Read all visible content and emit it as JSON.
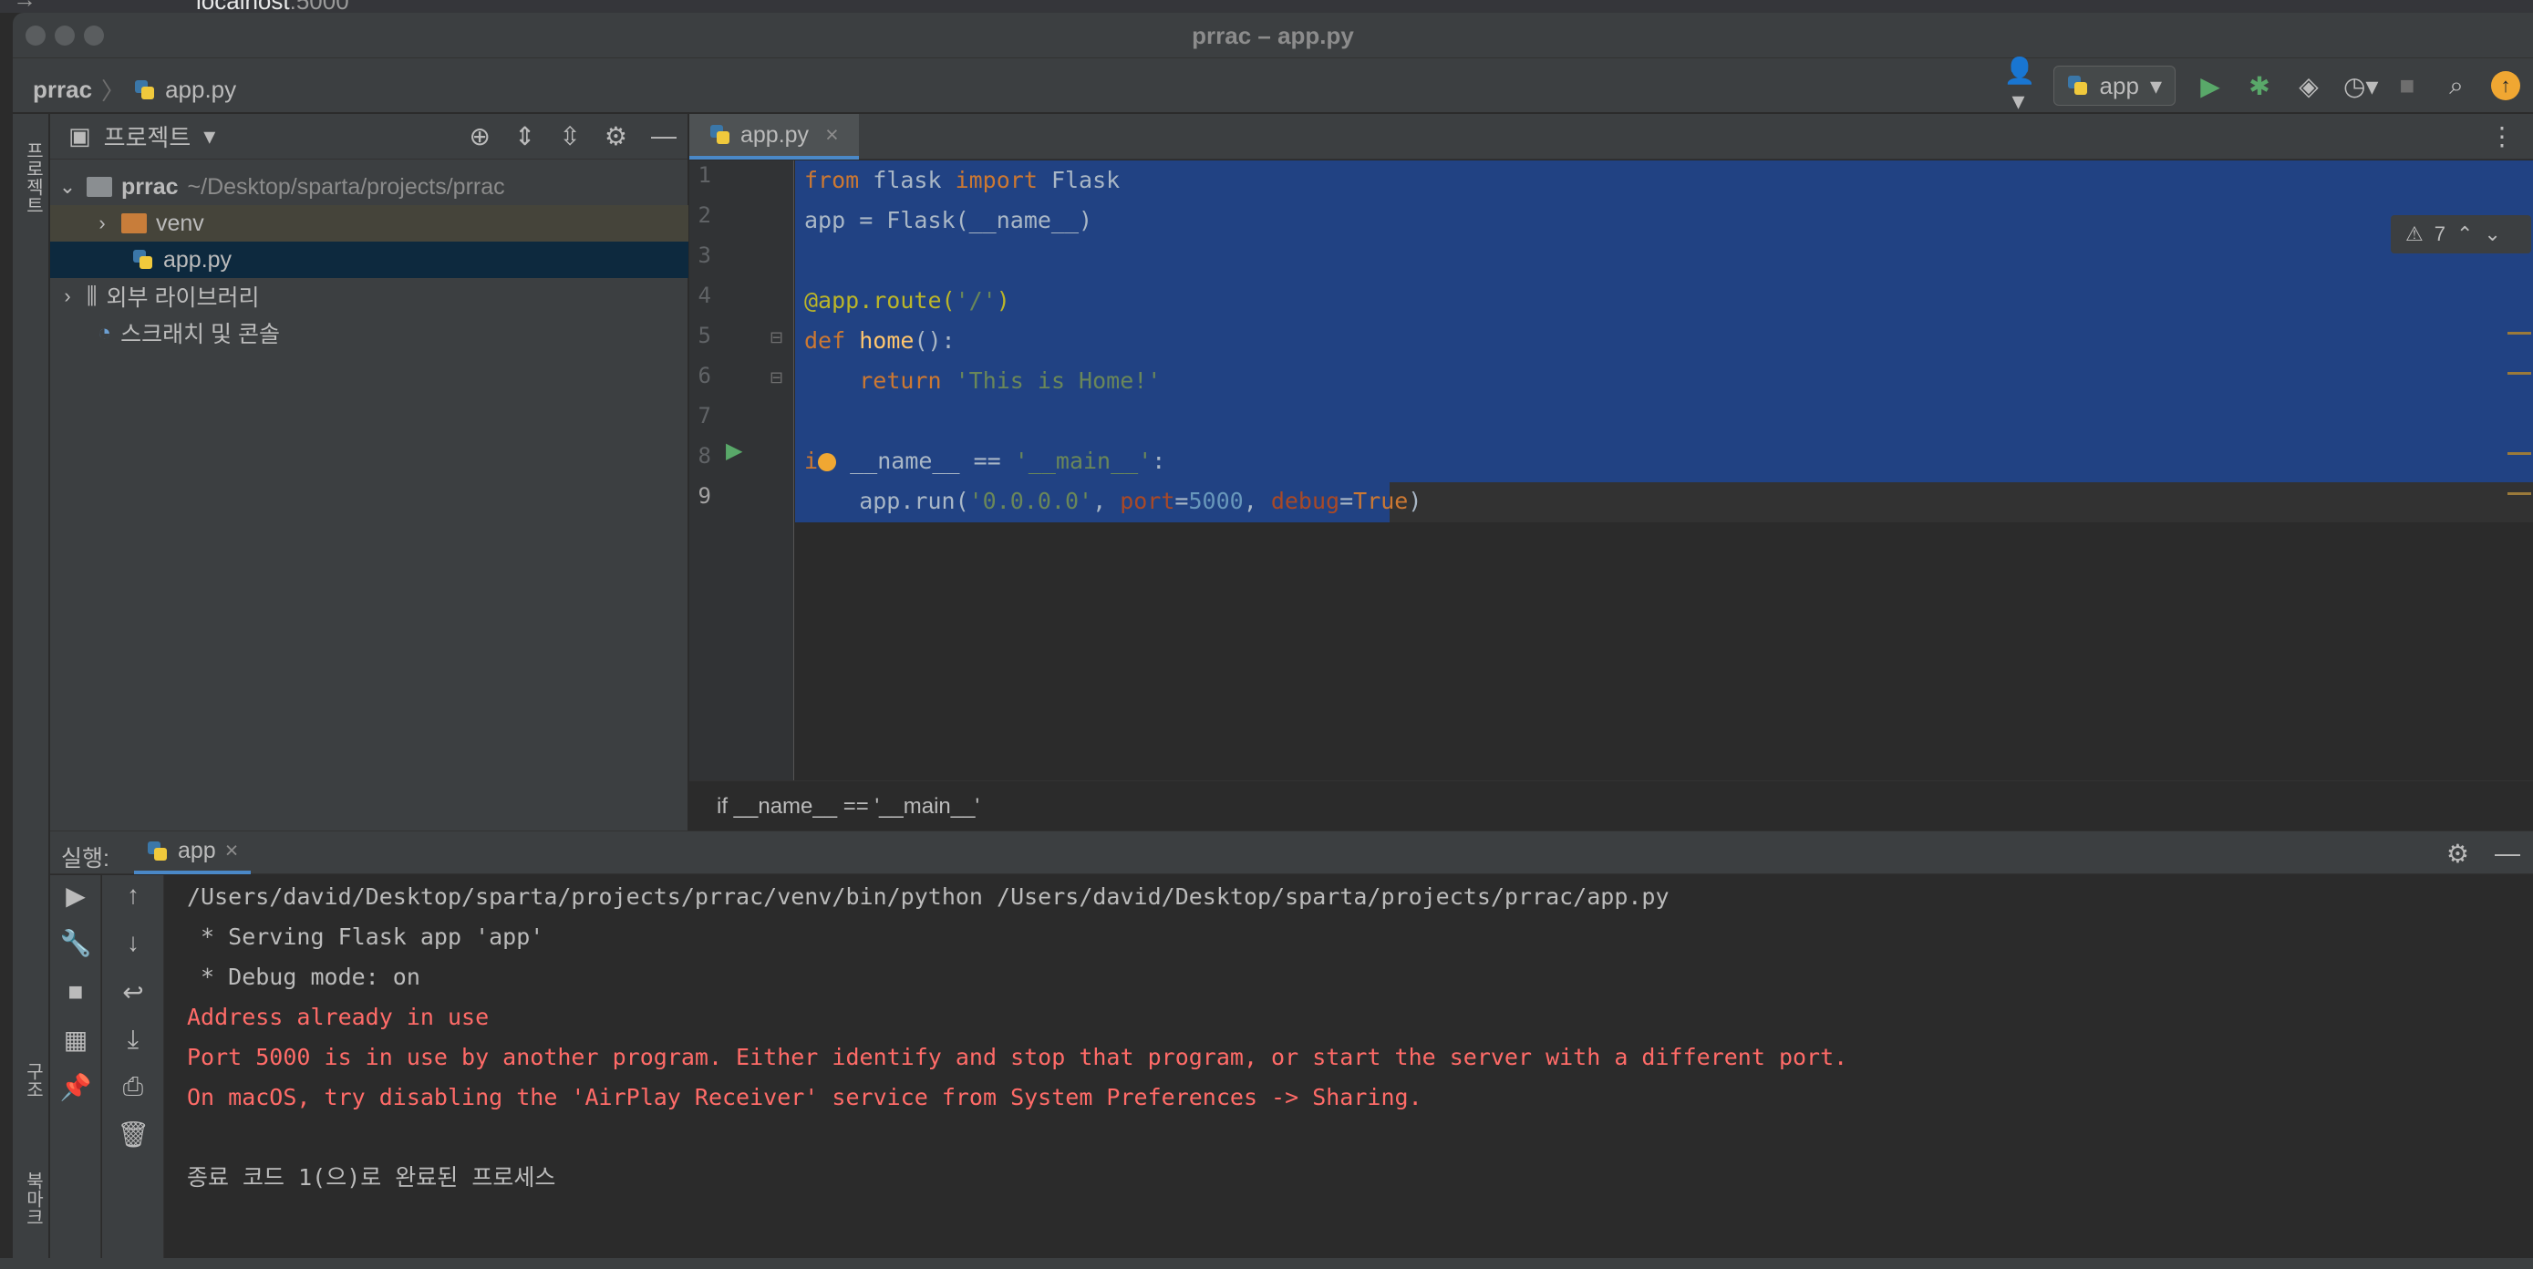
{
  "browser": {
    "url_host": "localhost",
    "url_port": ":5000"
  },
  "window": {
    "title": "prrac – app.py"
  },
  "navbar": {
    "project": "prrac",
    "file": "app.py",
    "run_config": "app"
  },
  "left_stripe": {
    "project_tab": "프로젝트",
    "structure_tab": "구조",
    "bookmarks_tab": "북마크"
  },
  "project_panel": {
    "title": "프로젝트",
    "root_name": "prrac",
    "root_path": "~/Desktop/sparta/projects/prrac",
    "items": [
      {
        "label": "venv"
      },
      {
        "label": "app.py"
      },
      {
        "label": "외부 라이브러리"
      },
      {
        "label": "스크래치 및 콘솔"
      }
    ]
  },
  "editor": {
    "tab_label": "app.py",
    "line_numbers": [
      "1",
      "2",
      "3",
      "4",
      "5",
      "6",
      "7",
      "8",
      "9"
    ],
    "inspection_count": "7",
    "breadcrumb": "if __name__ == '__main__'"
  },
  "run_panel": {
    "label": "실행:",
    "tab_label": "app",
    "console_lines": [
      {
        "text": "/Users/david/Desktop/sparta/projects/prrac/venv/bin/python /Users/david/Desktop/sparta/projects/prrac/app.py",
        "type": "normal"
      },
      {
        "text": " * Serving Flask app 'app'",
        "type": "normal"
      },
      {
        "text": " * Debug mode: on",
        "type": "normal"
      },
      {
        "text": "Address already in use",
        "type": "error"
      },
      {
        "text": "Port 5000 is in use by another program. Either identify and stop that program, or start the server with a different port.",
        "type": "error"
      },
      {
        "text": "On macOS, try disabling the 'AirPlay Receiver' service from System Preferences -> Sharing.",
        "type": "error"
      },
      {
        "text": "",
        "type": "normal"
      },
      {
        "text": "종료 코드 1(으)로 완료된 프로세스",
        "type": "normal"
      }
    ]
  },
  "colors": {
    "selection": "#214283",
    "keyword": "#cc7832",
    "string": "#6a8759",
    "error": "#ff6b68",
    "accent": "#4a88c7"
  }
}
